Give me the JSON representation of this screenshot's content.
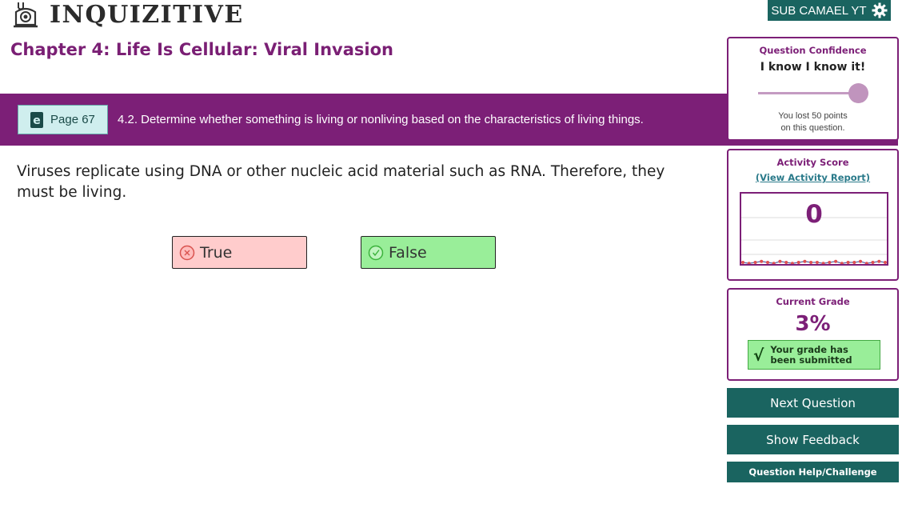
{
  "app": {
    "name": "INQUIZITIVE",
    "logo_icon": "owl-logo-icon"
  },
  "user": {
    "label": "SUB CAMAEL YT",
    "icon": "gear-icon"
  },
  "chapter": {
    "title": "Chapter 4: Life Is Cellular: Viral Invasion"
  },
  "objective_bar": {
    "ebook_icon": "ebook-icon",
    "page_label": "Page 67",
    "objective": "4.2. Determine whether something is living or nonliving based on the characteristics of living things."
  },
  "question": {
    "text": "Viruses replicate using DNA or other nucleic acid material such as RNA. Therefore, they must be living.",
    "answers": [
      {
        "label": "True",
        "state": "incorrect",
        "icon": "x-circle-icon",
        "color": "#ffcccc"
      },
      {
        "label": "False",
        "state": "correct",
        "icon": "check-circle-icon",
        "color": "#99ee99"
      }
    ]
  },
  "confidence": {
    "title": "Question Confidence",
    "value": "I know I know it!",
    "level": 1.0,
    "message_line1": "You lost 50 points",
    "message_line2": "on this question."
  },
  "activity": {
    "title": "Activity Score",
    "link": "(View Activity Report)",
    "score": "0",
    "history": [
      0,
      0,
      0,
      0,
      0,
      0,
      0,
      0,
      0,
      0,
      0,
      0,
      0,
      0,
      0,
      0,
      0,
      0,
      0,
      0,
      0,
      0,
      0,
      0
    ]
  },
  "grade": {
    "title": "Current Grade",
    "value": "3%",
    "check": "√",
    "submitted_line1": "Your grade has",
    "submitted_line2": "been submitted"
  },
  "actions": {
    "next": "Next Question",
    "feedback": "Show Feedback",
    "help": "Question Help/Challenge"
  },
  "colors": {
    "primary_purple": "#7c1f77",
    "teal": "#1a6460",
    "correct_green": "#99ee99",
    "incorrect_red": "#ffcccc"
  }
}
